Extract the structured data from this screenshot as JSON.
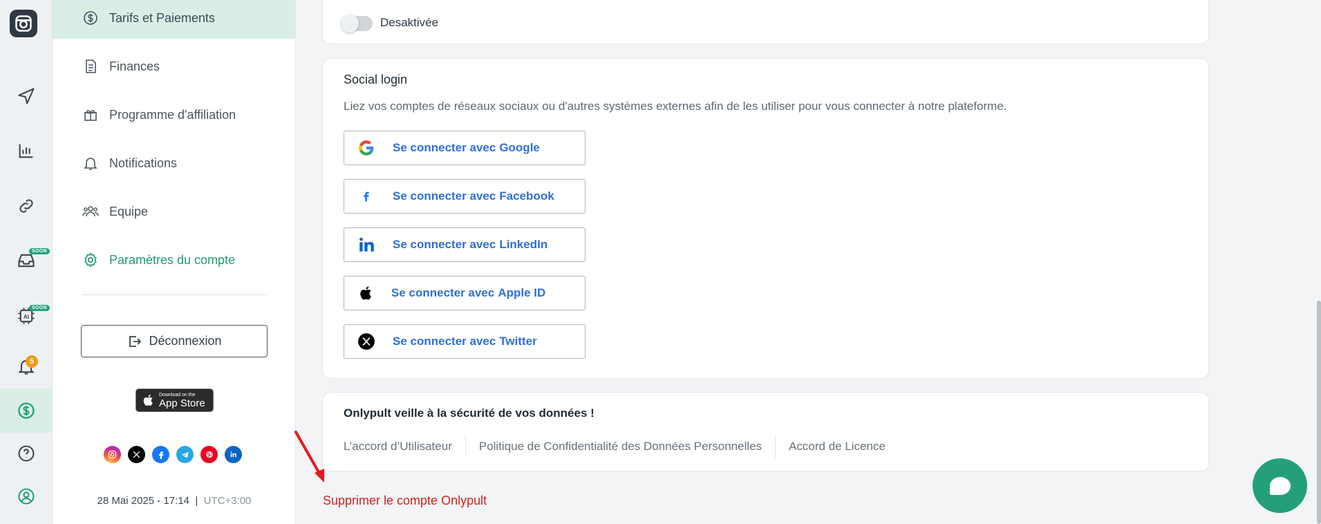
{
  "rail": {
    "notification_count": "5",
    "soon_label": "SOON"
  },
  "side_menu": {
    "items": [
      {
        "label": "Tarifs et Paiements",
        "icon": "dollar-circle-icon"
      },
      {
        "label": "Finances",
        "icon": "document-icon"
      },
      {
        "label": "Programme d'affiliation",
        "icon": "gift-icon"
      },
      {
        "label": "Notifications",
        "icon": "bell-icon"
      },
      {
        "label": "Equipe",
        "icon": "team-icon"
      },
      {
        "label": "Paramètres du compte",
        "icon": "gear-icon"
      }
    ],
    "logout_label": "Déconnexion",
    "appstore_small": "Download on the",
    "appstore_big": "App Store",
    "datetime": "28 Mai 2025 - 17:14",
    "timezone": "UTC+3:00",
    "separator": "|"
  },
  "toggle": {
    "label": "Desaktivée",
    "enabled": false
  },
  "social_login": {
    "title": "Social login",
    "description": "Liez vos comptes de réseaux sociaux ou d'autres systèmes externes afin de les utiliser pour vous connecter à notre plateforme.",
    "prefix": "Se connecter avec",
    "buttons": [
      {
        "brand": "Google",
        "icon": "google-icon"
      },
      {
        "brand": "Facebook",
        "icon": "facebook-icon"
      },
      {
        "brand": "LinkedIn",
        "icon": "linkedin-icon"
      },
      {
        "brand": "Apple ID",
        "icon": "apple-icon"
      },
      {
        "brand": "Twitter",
        "icon": "x-twitter-icon"
      }
    ]
  },
  "security": {
    "title": "Onlypult veille à la sécurité de vos données !",
    "links": [
      "L’accord d’Utilisateur",
      "Politique de Confidentialité des Données Personnelles",
      "Accord de Licence"
    ]
  },
  "delete_account_label": "Supprimer le compte Onlypult",
  "colors": {
    "accent": "#23a07a",
    "link_blue": "#2f6fd6",
    "danger": "#d61f1f",
    "badge_orange": "#f59a17"
  }
}
